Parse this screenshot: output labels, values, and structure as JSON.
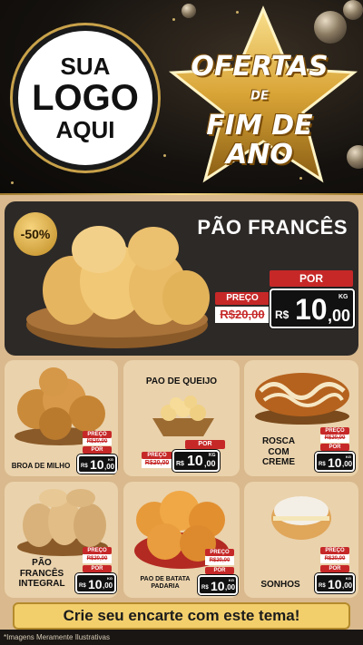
{
  "header": {
    "logo": {
      "line1": "SUA",
      "line2": "LOGO",
      "line3": "AQUI"
    },
    "promo": {
      "line1": "OFERTAS",
      "de": "DE",
      "line2": "FIM DE ANO"
    }
  },
  "hero": {
    "title": "PÃO FRANCÊS",
    "discount": "-50%",
    "price": {
      "preco_label": "PREÇO",
      "old": "R$20,00",
      "por_label": "POR",
      "currency": "R$",
      "integer": "10",
      "decimals": ",00",
      "unit": "KG"
    }
  },
  "products": [
    {
      "name": "BROA DE MILHO",
      "preco_label": "PREÇO",
      "old": "R$20,00",
      "por_label": "POR",
      "currency": "R$",
      "integer": "10",
      "decimals": ",00",
      "unit": "KG"
    },
    {
      "name": "PAO DE QUEIJO",
      "preco_label": "PREÇO",
      "old": "R$20,00",
      "por_label": "POR",
      "currency": "R$",
      "integer": "10",
      "decimals": ",00",
      "unit": "KG"
    },
    {
      "name_line1": "ROSCA",
      "name_line2": "COM",
      "name_line3": "CREME",
      "preco_label": "PREÇO",
      "old": "R$20,00",
      "por_label": "POR",
      "currency": "R$",
      "integer": "10",
      "decimals": ",00",
      "unit": "KG"
    },
    {
      "name_line1": "PÃO",
      "name_line2": "FRANCÊS",
      "name_line3": "INTEGRAL",
      "preco_label": "PREÇO",
      "old": "R$20,00",
      "por_label": "POR",
      "currency": "R$",
      "integer": "10",
      "decimals": ",00",
      "unit": "KG"
    },
    {
      "name_line1": "PAO DE BATATA",
      "name_line2": "PADARIA",
      "preco_label": "PREÇO",
      "old": "R$20,00",
      "por_label": "POR",
      "currency": "R$",
      "integer": "10",
      "decimals": ",00",
      "unit": "KG"
    },
    {
      "name": "SONHOS",
      "preco_label": "PREÇO",
      "old": "R$20,00",
      "por_label": "POR",
      "currency": "R$",
      "integer": "10",
      "decimals": ",00",
      "unit": "KG"
    }
  ],
  "footer": {
    "cta": "Crie seu encarte com este tema!",
    "disclaimer": "*Imagens Meramente Ilustrativas"
  },
  "colors": {
    "accent_red": "#c62828",
    "gold": "#f3cf6c",
    "card_bg": "#ead2ac",
    "hero_bg": "#2d2927"
  }
}
